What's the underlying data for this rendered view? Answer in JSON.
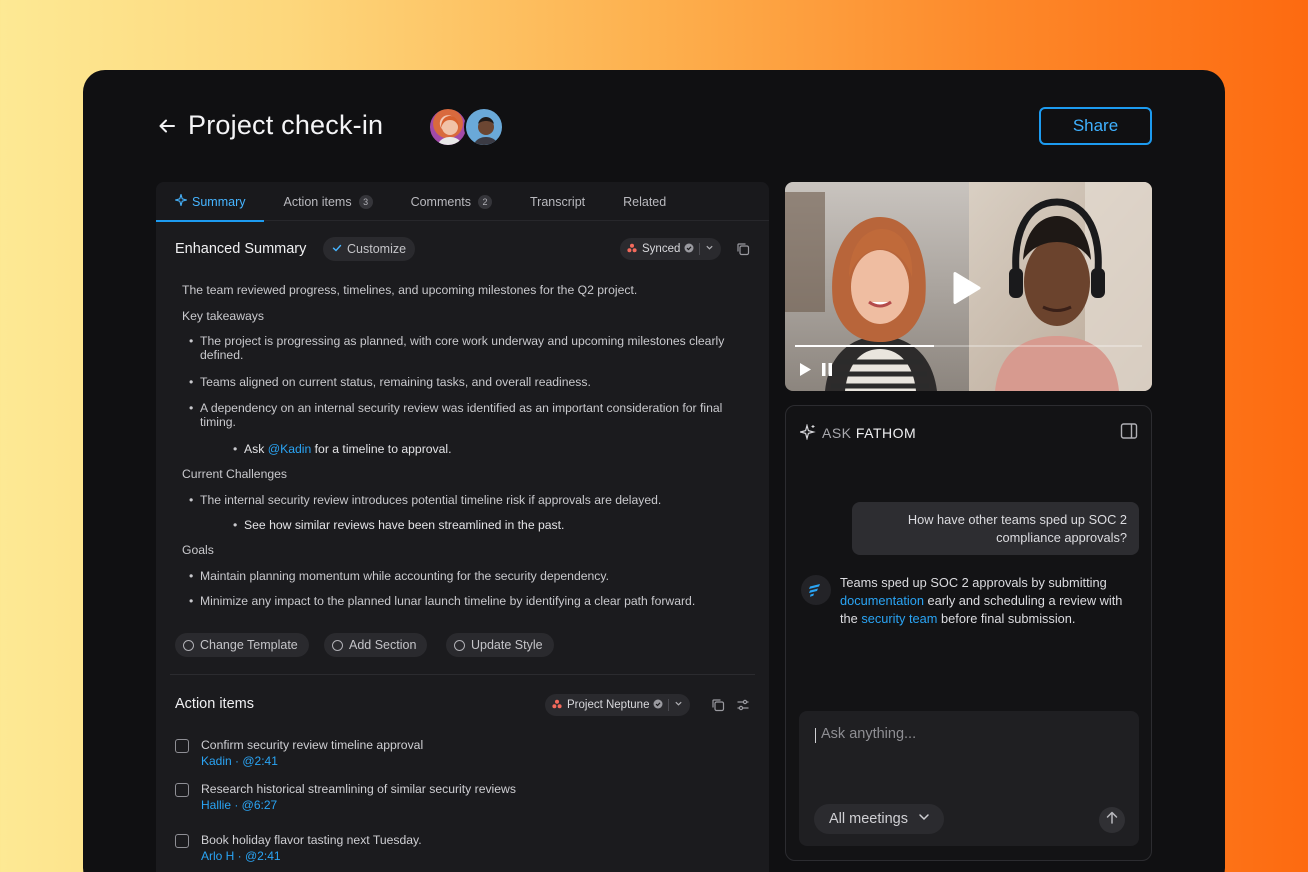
{
  "header": {
    "title": "Project check-in",
    "share_label": "Share"
  },
  "tabs": [
    {
      "label": "Summary",
      "active": true
    },
    {
      "label": "Action items",
      "badge": "3"
    },
    {
      "label": "Comments",
      "badge": "2"
    },
    {
      "label": "Transcript"
    },
    {
      "label": "Related"
    }
  ],
  "summary": {
    "title": "Enhanced Summary",
    "customize_label": "Customize",
    "synced_label": "Synced",
    "intro": "The team reviewed progress, timelines, and upcoming milestones for the Q2 project.",
    "key_takeaways_heading": "Key takeaways",
    "takeaway_1": "The project is progressing as planned, with core work underway and upcoming milestones clearly defined.",
    "takeaway_2": "Teams aligned on current status, remaining tasks, and overall readiness.",
    "takeaway_3": "A dependency on an internal security review was identified as an important consideration for final timing.",
    "sub_1_prefix": "Ask",
    "sub_1_mention": "@Kadin",
    "sub_1_suffix": "for a timeline to approval.",
    "challenges_heading": "Current Challenges",
    "challenge_1": "The internal security review introduces potential timeline risk if approvals are delayed.",
    "challenge_sub_1": "See how similar reviews have been streamlined in the past.",
    "goals_heading": "Goals",
    "goal_1": "Maintain planning momentum while accounting for the security dependency.",
    "goal_2": "Minimize any impact to the planned lunar launch timeline by identifying a clear path forward.",
    "actions": {
      "change_template": "Change Template",
      "add_section": "Add Section",
      "update_style": "Update Style"
    }
  },
  "action_items": {
    "title": "Action items",
    "project_label": "Project Neptune",
    "items": [
      {
        "text": "Confirm security review timeline approval",
        "meta": "Kadin · @2:41"
      },
      {
        "text": "Research historical streamlining of similar security reviews",
        "meta": "Hallie · @6:27"
      },
      {
        "text": "Book holiday flavor tasting next Tuesday.",
        "meta": "Arlo H · @2:41"
      }
    ]
  },
  "video": {
    "progress": 0.4
  },
  "ask": {
    "title_prefix": "ASK",
    "title_brand": "FATHOM",
    "user_message": "How have other teams sped up SOC 2 compliance approvals?",
    "bot_part_1": "Teams sped up SOC 2 approvals by submitting",
    "bot_link_1": "documentation",
    "bot_part_2": "early and scheduling a review with the",
    "bot_link_2": "security team",
    "bot_part_3": "before final submission.",
    "input_placeholder": "Ask anything...",
    "scope_label": "All meetings"
  },
  "colors": {
    "accent": "#1d9bf0",
    "panel_bg": "#1b1b1e",
    "app_bg": "#101012"
  }
}
